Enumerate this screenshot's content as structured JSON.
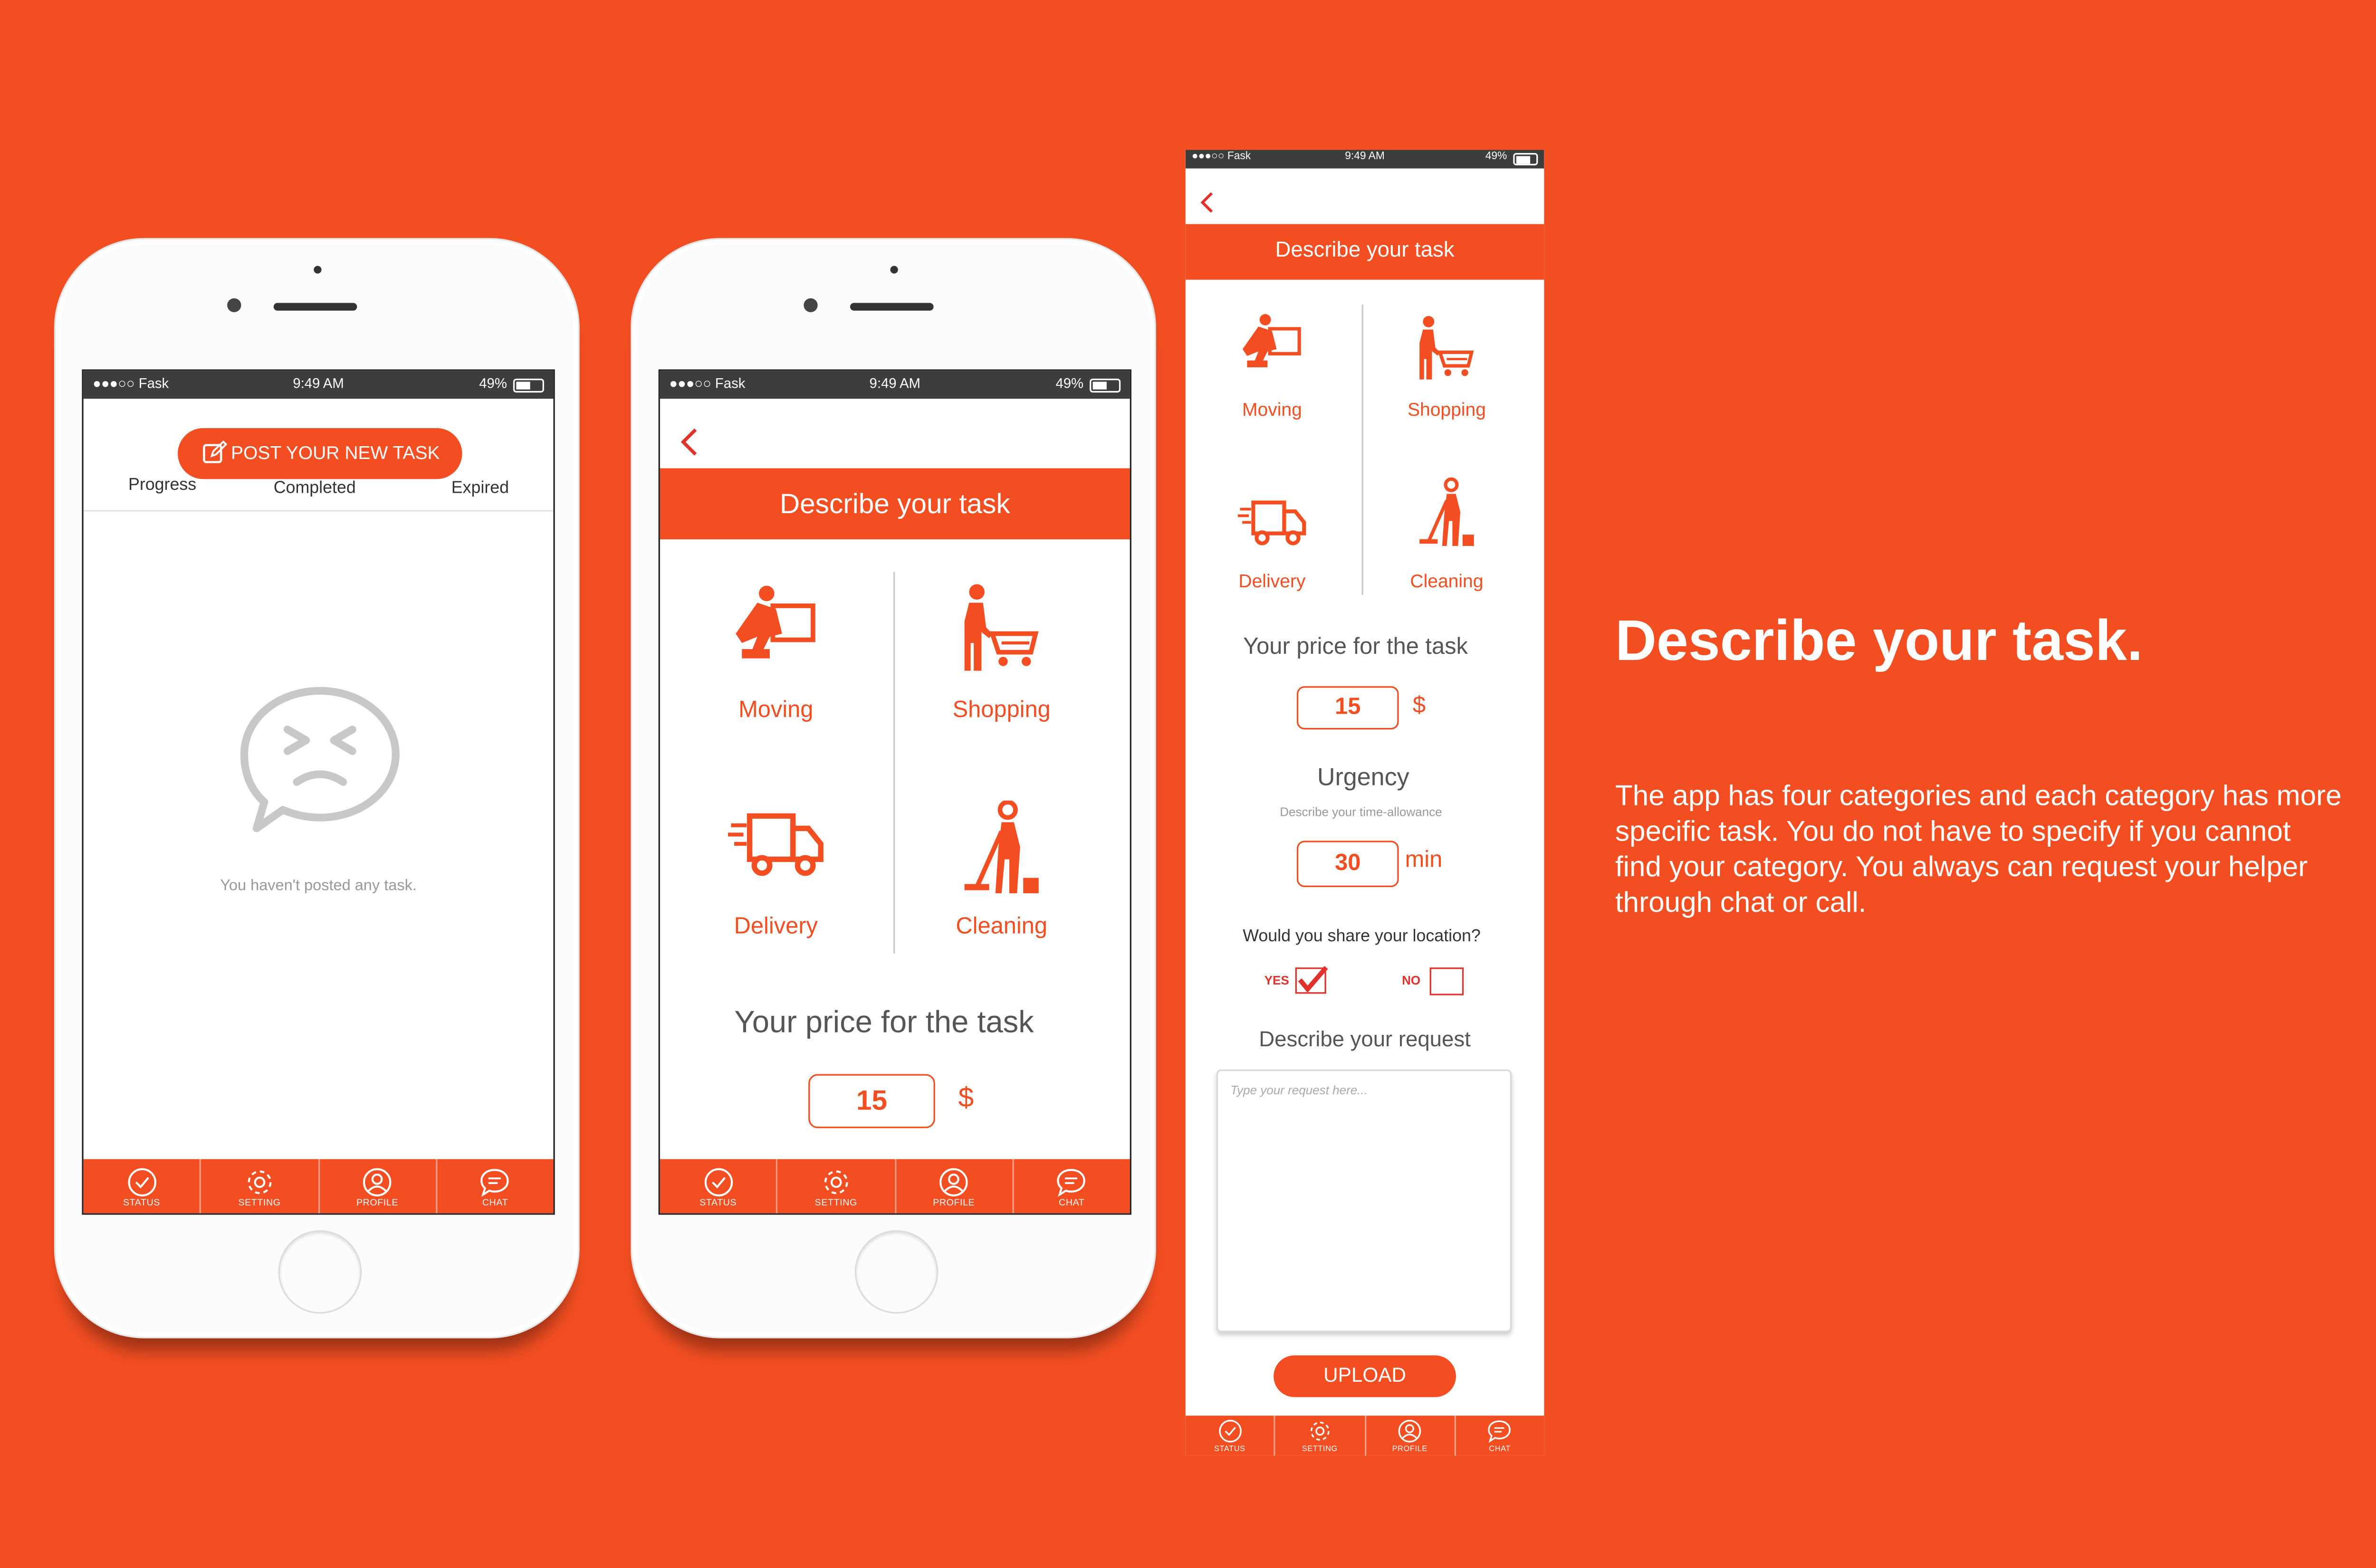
{
  "status_bar": {
    "carrier": "●●●○○ Fask",
    "time": "9:49 AM",
    "battery": "49%"
  },
  "tabs": [
    {
      "label": "STATUS",
      "icon": "check-circle-icon"
    },
    {
      "label": "SETTING",
      "icon": "gear-icon"
    },
    {
      "label": "PROFILE",
      "icon": "user-icon"
    },
    {
      "label": "CHAT",
      "icon": "chat-bubble-icon"
    }
  ],
  "screen1": {
    "post_button": "POST YOUR NEW TASK",
    "tabs": [
      "Progress",
      "Completed",
      "Expired"
    ],
    "empty_message": "You haven't posted any task."
  },
  "screen2": {
    "header": "Describe your task",
    "categories": [
      "Moving",
      "Shopping",
      "Delivery",
      "Cleaning"
    ],
    "price_label": "Your price for the task",
    "price_value": "15",
    "currency": "$"
  },
  "screen3": {
    "header": "Describe your task",
    "categories": [
      "Moving",
      "Shopping",
      "Delivery",
      "Cleaning"
    ],
    "price_label": "Your price for the task",
    "price_value": "15",
    "currency": "$",
    "urgency_label": "Urgency",
    "urgency_hint": "Describe your time-allowance",
    "urgency_value": "30",
    "urgency_unit": "min",
    "location_question": "Would you share your location?",
    "yes_label": "YES",
    "no_label": "NO",
    "yes_checked": true,
    "no_checked": false,
    "request_label": "Describe your request",
    "request_placeholder": "Type your request here...",
    "upload_button": "UPLOAD"
  },
  "headline": "Describe your task.",
  "description": "The app has four categories and each category has more specific task. You do not have to specify if you cannot find your category. You always can request your helper through chat or call.",
  "colors": {
    "brand": "#f24e22",
    "red_accent": "#e0322a"
  }
}
